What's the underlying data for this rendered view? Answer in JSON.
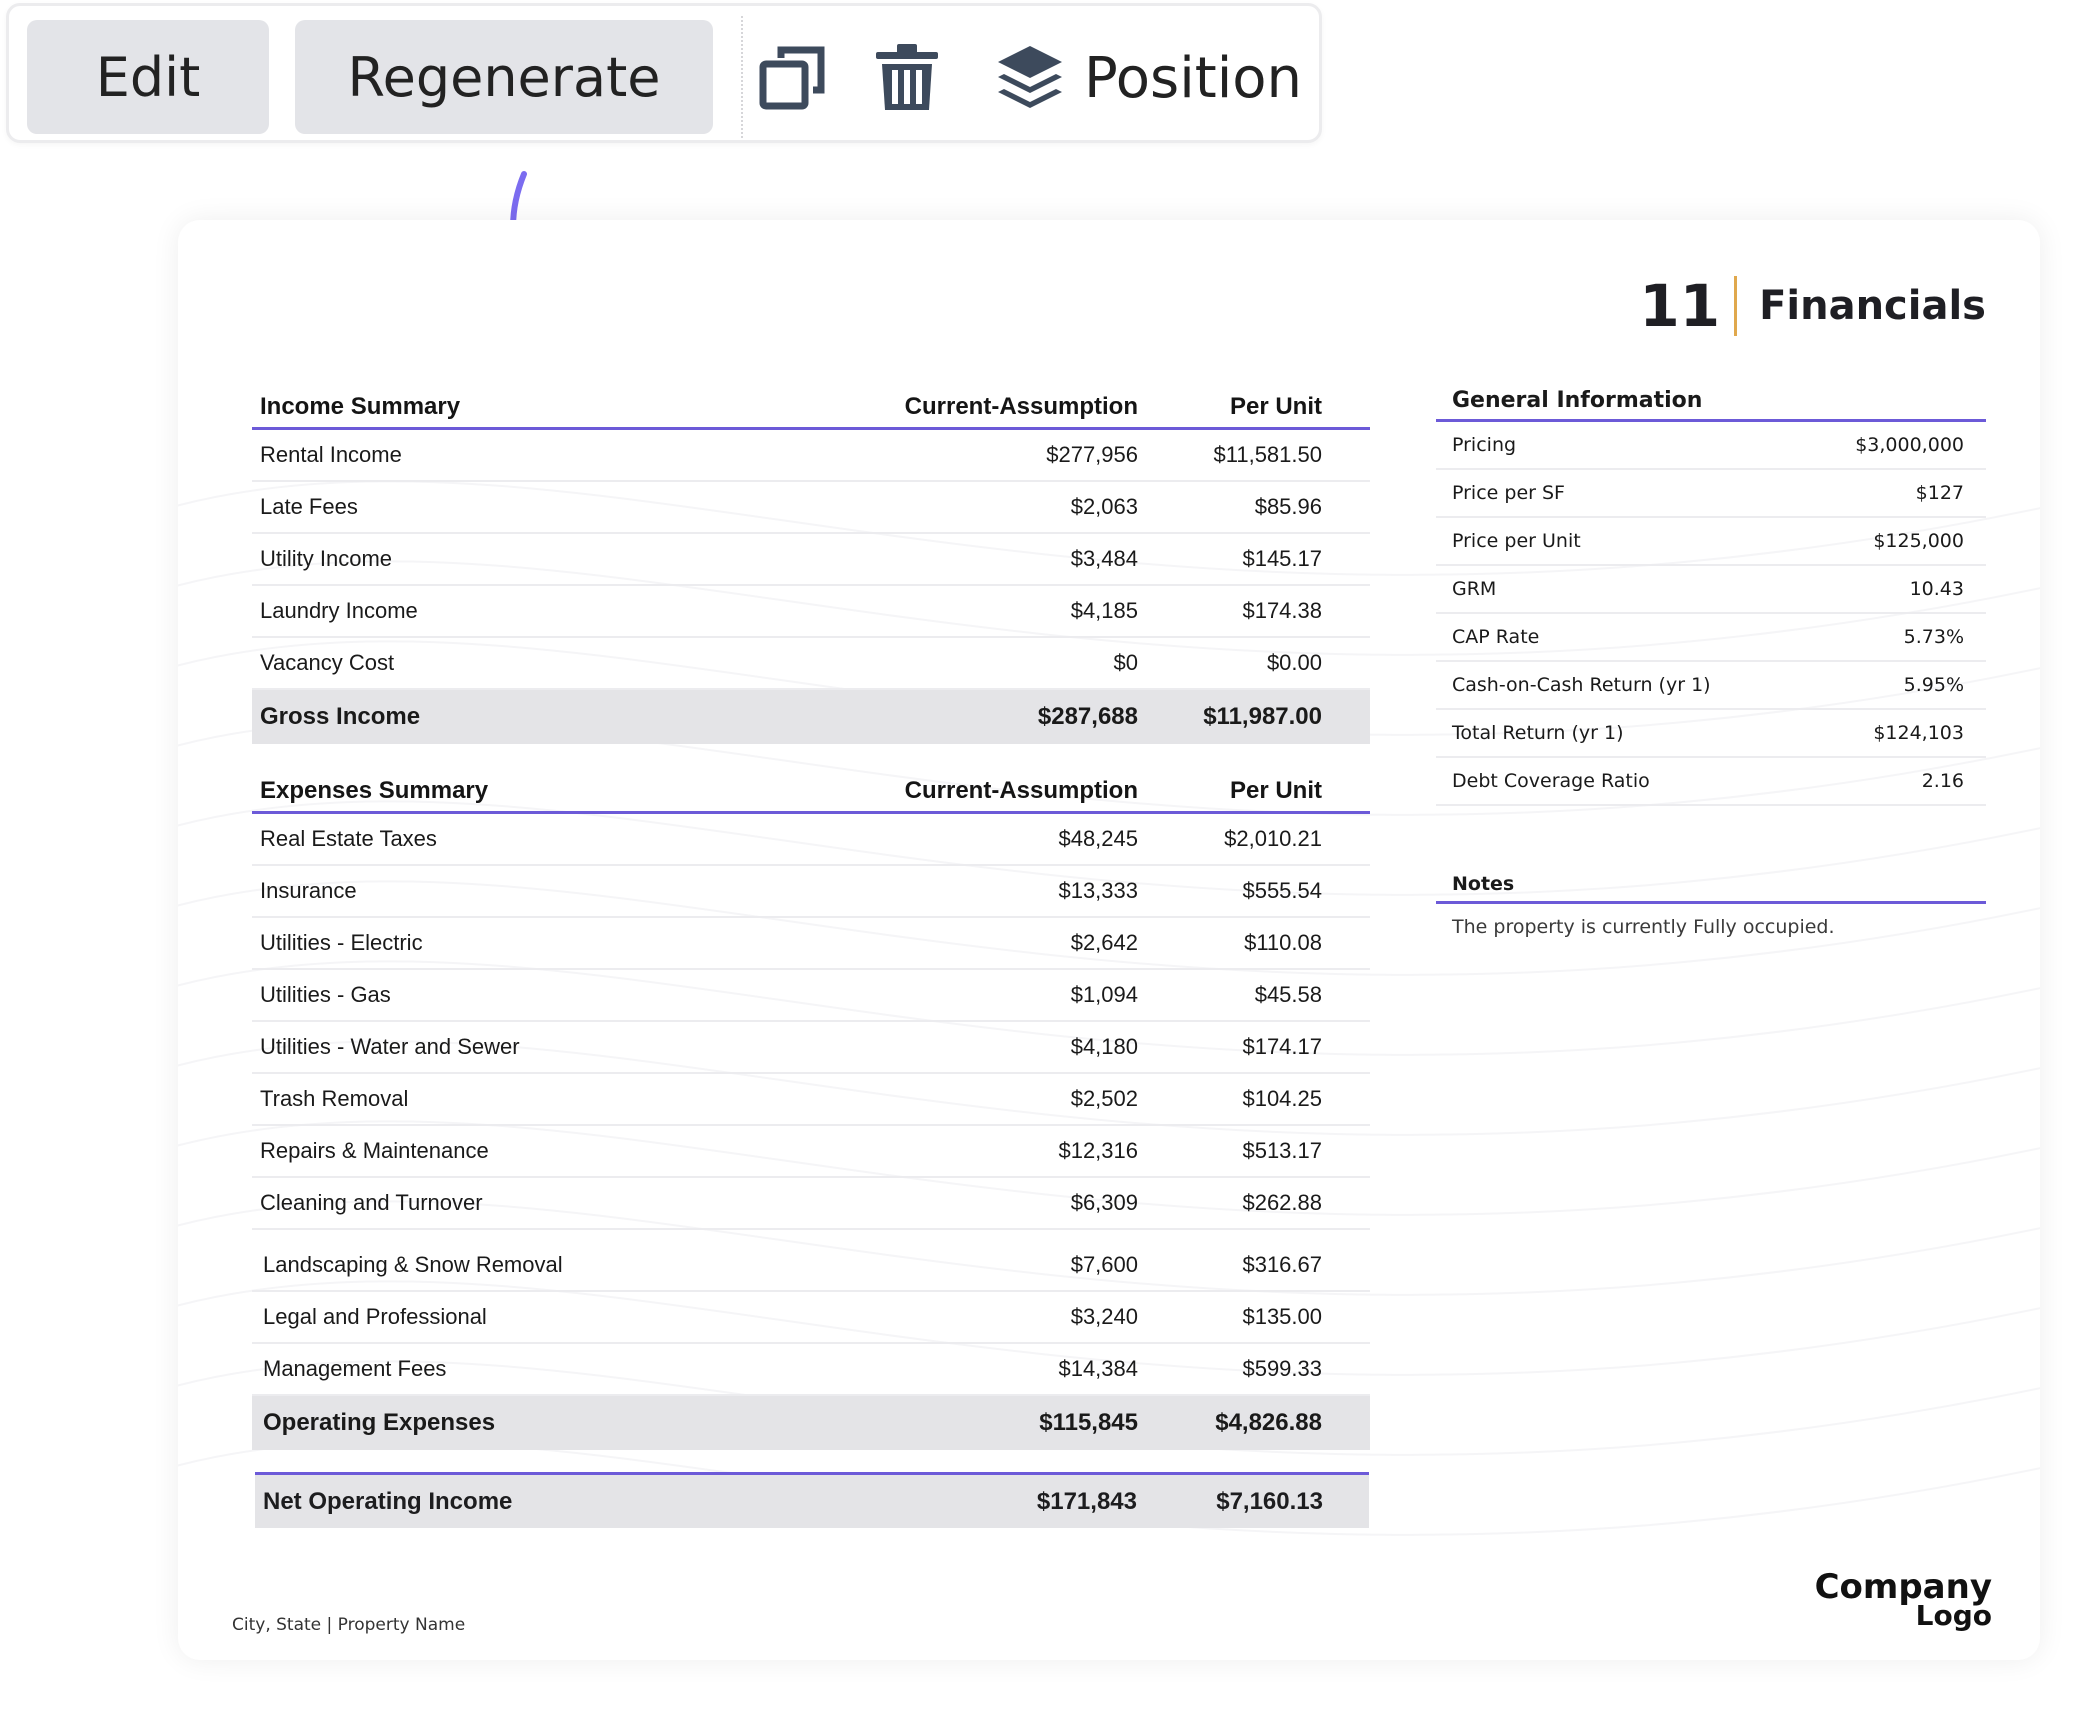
{
  "toolbar": {
    "edit_label": "Edit",
    "regenerate_label": "Regenerate",
    "duplicate_icon": "duplicate-icon",
    "delete_icon": "trash-icon",
    "position_icon": "layers-icon",
    "position_label": "Position"
  },
  "colors": {
    "accent": "#6c5ad8",
    "arrow": "#7b6cf0",
    "heading_divider": "#e0a84d",
    "total_row_bg": "#e4e4e7",
    "button_bg": "#e3e4e8"
  },
  "page": {
    "number": "11",
    "title": "Financials",
    "footer": "City, State | Property Name",
    "logo_line1": "Company",
    "logo_line2": "Logo"
  },
  "income": {
    "headers": [
      "Income Summary",
      "Current-Assumption",
      "Per Unit"
    ],
    "rows": [
      [
        "Rental Income",
        "$277,956",
        "$11,581.50"
      ],
      [
        "Late Fees",
        "$2,063",
        "$85.96"
      ],
      [
        "Utility Income",
        "$3,484",
        "$145.17"
      ],
      [
        "Laundry Income",
        "$4,185",
        "$174.38"
      ],
      [
        "Vacancy Cost",
        "$0",
        "$0.00"
      ]
    ],
    "total": [
      "Gross Income",
      "$287,688",
      "$11,987.00"
    ]
  },
  "expenses": {
    "headers": [
      "Expenses Summary",
      "Current-Assumption",
      "Per Unit"
    ],
    "rows": [
      [
        "Real Estate Taxes",
        "$48,245",
        "$2,010.21"
      ],
      [
        "Insurance",
        "$13,333",
        "$555.54"
      ],
      [
        "Utilities - Electric",
        "$2,642",
        "$110.08"
      ],
      [
        "Utilities - Gas",
        "$1,094",
        "$45.58"
      ],
      [
        "Utilities - Water and Sewer",
        "$4,180",
        "$174.17"
      ],
      [
        "Trash Removal",
        "$2,502",
        "$104.25"
      ],
      [
        "Repairs & Maintenance",
        "$12,316",
        "$513.17"
      ],
      [
        "Cleaning and Turnover",
        "$6,309",
        "$262.88"
      ],
      [
        "Landscaping & Snow Removal",
        "$7,600",
        "$316.67"
      ],
      [
        "Legal and Professional",
        "$3,240",
        "$135.00"
      ],
      [
        "Management Fees",
        "$14,384",
        "$599.33"
      ]
    ],
    "total": [
      "Operating Expenses",
      "$115,845",
      "$4,826.88"
    ]
  },
  "noi": [
    "Net Operating Income",
    "$171,843",
    "$7,160.13"
  ],
  "general_info": {
    "title": "General Information",
    "rows": [
      [
        "Pricing",
        "$3,000,000"
      ],
      [
        "Price per SF",
        "$127"
      ],
      [
        "Price per Unit",
        "$125,000"
      ],
      [
        "GRM",
        "10.43"
      ],
      [
        "CAP Rate",
        "5.73%"
      ],
      [
        "Cash-on-Cash Return (yr 1)",
        "5.95%"
      ],
      [
        "Total Return (yr 1)",
        "$124,103"
      ],
      [
        "Debt Coverage Ratio",
        "2.16"
      ]
    ]
  },
  "notes": {
    "title": "Notes",
    "text": "The property is currently Fully occupied."
  }
}
